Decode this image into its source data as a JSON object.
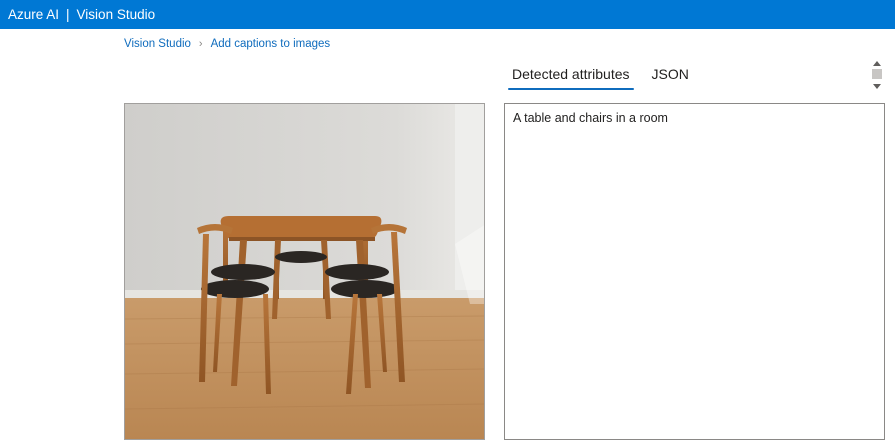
{
  "header": {
    "brand": "Azure AI",
    "separator": "|",
    "product": "Vision Studio"
  },
  "breadcrumb": {
    "items": [
      "Vision Studio",
      "Add captions to images"
    ],
    "separator_icon": "chevron-right-icon"
  },
  "tabs": [
    {
      "label": "Detected attributes",
      "active": true
    },
    {
      "label": "JSON",
      "active": false
    }
  ],
  "result": {
    "caption": "A table and chairs in a room"
  },
  "colors": {
    "topbar": "#0078d4",
    "link": "#0f6cbd",
    "tab_underline": "#0f6cbd"
  }
}
